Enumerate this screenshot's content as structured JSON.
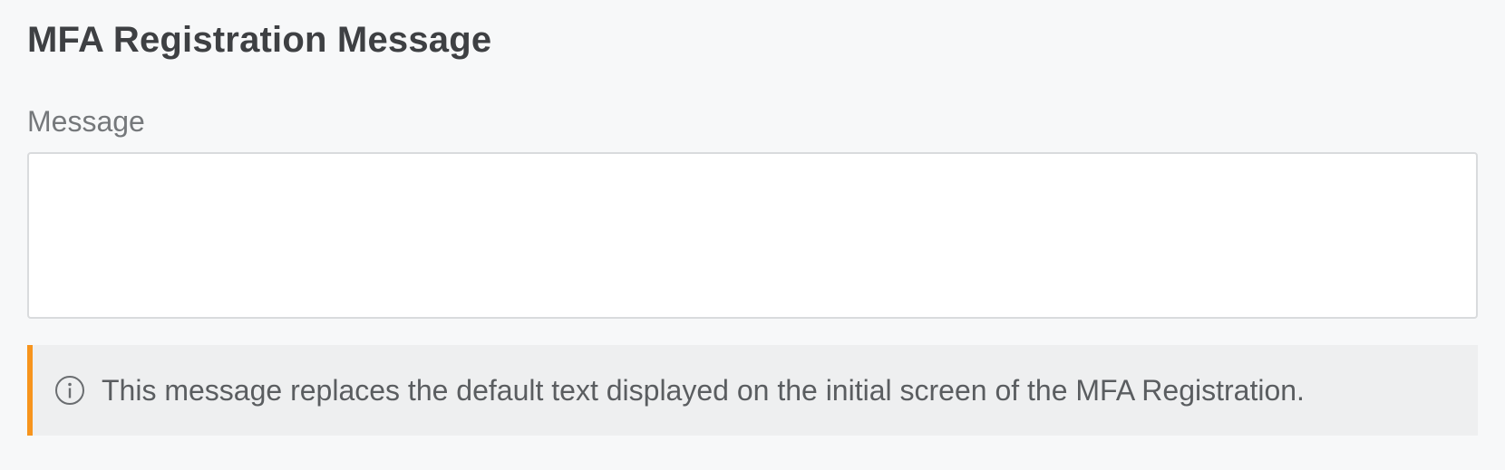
{
  "section": {
    "title": "MFA Registration Message"
  },
  "message_field": {
    "label": "Message",
    "value": "",
    "placeholder": ""
  },
  "info_callout": {
    "icon": "info-circle-icon",
    "text": "This message replaces the default text displayed on the initial screen of the MFA Registration.",
    "accent_color": "#f7941d"
  }
}
